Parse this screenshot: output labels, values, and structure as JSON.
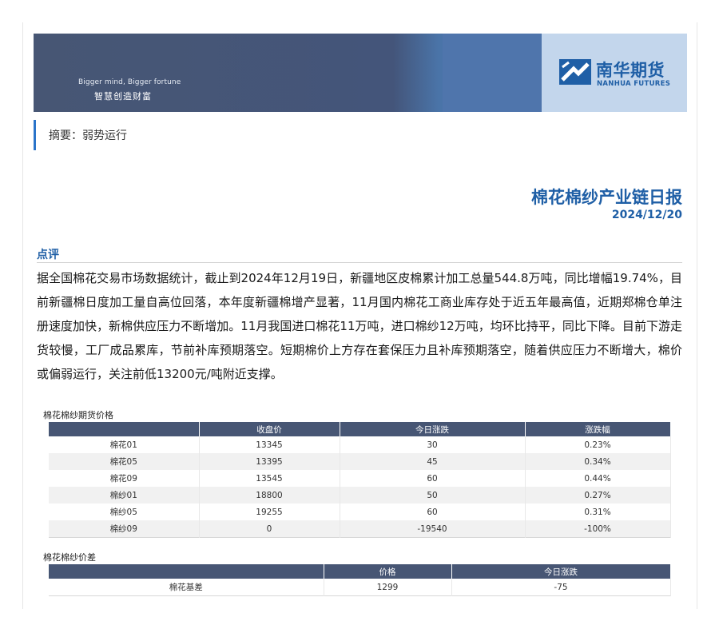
{
  "banner": {
    "slogan_en": "Bigger mind, Bigger fortune",
    "slogan_cn": "智慧创造财富",
    "logo_cn": "南华期货",
    "logo_en": "NANHUA FUTURES"
  },
  "summary": "摘要：弱势运行",
  "report": {
    "title": "棉花棉纱产业链日报",
    "date": "2024/12/20"
  },
  "commentary": {
    "heading": "点评",
    "text": "据全国棉花交易市场数据统计，截止到2024年12月19日，新疆地区皮棉累计加工总量544.8万吨，同比增幅19.74%，目前新疆棉日度加工量自高位回落，本年度新疆棉增产显著，11月国内棉花工商业库存处于近五年最高值，近期郑棉仓单注册速度加快，新棉供应压力不断增加。11月我国进口棉花11万吨，进口棉纱12万吨，均环比持平，同比下降。目前下游走货较慢，工厂成品累库，节前补库预期落空。短期棉价上方存在套保压力且补库预期落空，随着供应压力不断增大，棉价或偏弱运行，关注前低13200元/吨附近支撑。"
  },
  "futures_table": {
    "title": "棉花棉纱期货价格",
    "headers": [
      "",
      "收盘价",
      "今日涨跌",
      "涨跌幅"
    ],
    "rows": [
      [
        "棉花01",
        "13345",
        "30",
        "0.23%"
      ],
      [
        "棉花05",
        "13395",
        "45",
        "0.34%"
      ],
      [
        "棉花09",
        "13545",
        "60",
        "0.44%"
      ],
      [
        "棉纱01",
        "18800",
        "50",
        "0.27%"
      ],
      [
        "棉纱05",
        "19255",
        "60",
        "0.31%"
      ],
      [
        "棉纱09",
        "0",
        "-19540",
        "-100%"
      ]
    ]
  },
  "spread_table": {
    "title": "棉花棉纱价差",
    "headers": [
      "",
      "价格",
      "今日涨跌"
    ],
    "rows": [
      [
        "棉花基差",
        "1299",
        "-75"
      ]
    ]
  },
  "colors": {
    "brand_blue": "#1f5fa6",
    "header_navy": "#475674",
    "accent_bar": "#2a74c9"
  }
}
